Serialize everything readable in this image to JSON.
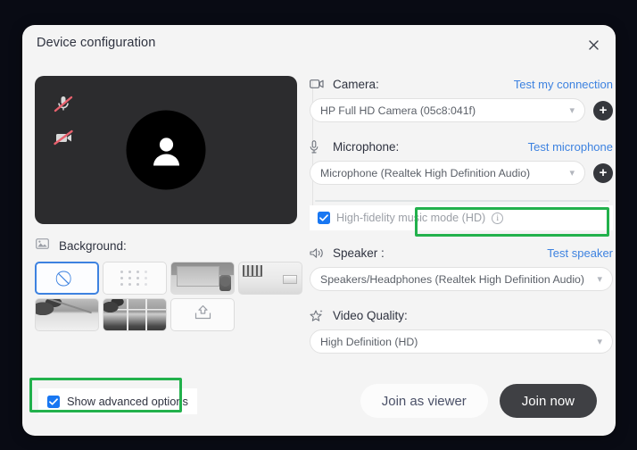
{
  "dialog": {
    "title": "Device configuration",
    "close_icon": "close-icon"
  },
  "preview": {
    "mic_muted_icon": "microphone-muted-icon",
    "camera_muted_icon": "camera-muted-icon",
    "avatar_icon": "person-avatar-icon"
  },
  "background": {
    "icon": "image-icon",
    "label": "Background:",
    "options": [
      {
        "name": "none",
        "icon": "no-background-icon",
        "selected": true
      },
      {
        "name": "blur",
        "icon": "blur-dots-icon",
        "selected": false
      },
      {
        "name": "room",
        "icon": "room-thumbnail",
        "selected": false
      },
      {
        "name": "office",
        "icon": "office-thumbnail",
        "selected": false
      },
      {
        "name": "beach",
        "icon": "beach-thumbnail",
        "selected": false
      },
      {
        "name": "window-view",
        "icon": "window-thumbnail",
        "selected": false
      },
      {
        "name": "upload",
        "icon": "upload-icon",
        "selected": false
      }
    ]
  },
  "camera": {
    "icon": "camera-icon",
    "label": "Camera:",
    "action": "Test my connection",
    "value": "HP Full HD Camera (05c8:041f)",
    "add_label": "+"
  },
  "microphone": {
    "icon": "microphone-icon",
    "label": "Microphone:",
    "action": "Test microphone",
    "value": "Microphone (Realtek High Definition Audio)",
    "add_label": "+"
  },
  "hifi": {
    "label": "High-fidelity music mode (HD)",
    "checked": true,
    "info_icon": "info-icon",
    "info_glyph": "i"
  },
  "speaker": {
    "icon": "speaker-icon",
    "label": "Speaker :",
    "action": "Test speaker",
    "value": "Speakers/Headphones (Realtek High Definition Audio)"
  },
  "video_quality": {
    "icon": "sparkle-star-icon",
    "label": "Video Quality:",
    "value": "High Definition (HD)"
  },
  "advanced": {
    "label": "Show advanced options",
    "checked": true
  },
  "footer": {
    "join_viewer_label": "Join as viewer",
    "join_now_label": "Join now"
  },
  "highlights": {
    "accent_color": "#22b14c",
    "targets": [
      "High-fidelity music mode (HD)",
      "Show advanced options"
    ]
  },
  "colors": {
    "link": "#3d82e0",
    "checkbox": "#1877f2",
    "primary_button": "#3f4044",
    "backdrop": "#090b14"
  }
}
